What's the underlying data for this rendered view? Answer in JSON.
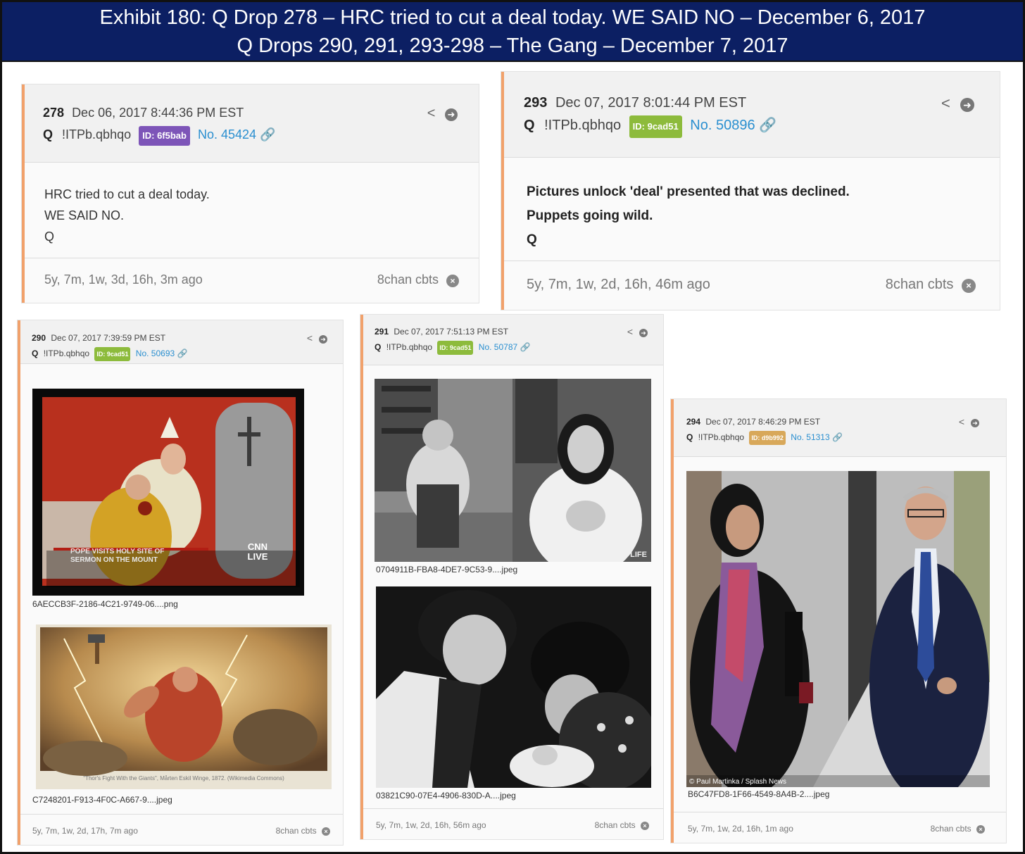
{
  "banner": {
    "line1": "Exhibit 180: Q Drop 278 – HRC tried to cut a deal today. WE SAID NO – December 6, 2017",
    "line2": "Q Drops 290, 291, 293-298 – The Gang – December 7, 2017"
  },
  "posts": [
    {
      "num": "278",
      "date": "Dec 06, 2017 8:44:36 PM EST",
      "author": "Q",
      "trip": "!ITPb.qbhqo",
      "id_label": "ID: 6f5bab",
      "post_no": "No. 45424",
      "lines": [
        "HRC tried to cut a deal today.",
        "WE SAID NO.",
        "Q"
      ],
      "ago": "5y, 7m, 1w, 3d, 16h, 3m ago",
      "board": "8chan cbts"
    },
    {
      "num": "293",
      "date": "Dec 07, 2017 8:01:44 PM EST",
      "author": "Q",
      "trip": "!ITPb.qbhqo",
      "id_label": "ID: 9cad51",
      "post_no": "No. 50896",
      "lines": [
        "Pictures unlock 'deal' presented that was declined.",
        "Puppets going wild.",
        "Q"
      ],
      "ago": "5y, 7m, 1w, 2d, 16h, 46m ago",
      "board": "8chan cbts"
    },
    {
      "num": "290",
      "date": "Dec 07, 2017 7:39:59 PM EST",
      "author": "Q",
      "trip": "!ITPb.qbhqo",
      "id_label": "ID: 9cad51",
      "post_no": "No. 50693",
      "images": [
        {
          "caption": "POPE VISITS HOLY SITE OF SERMON ON THE MOUNT",
          "logo": "CNN LIVE",
          "file": "6AECCB3F-2186-4C21-9749-06....png"
        },
        {
          "caption": "\"Thor's Fight With the Giants\", Mårten Eskil Winge, 1872. (Wikimedia Commons)",
          "file": "C7248201-F913-4F0C-A667-9....jpeg"
        }
      ],
      "ago": "5y, 7m, 1w, 2d, 17h, 7m ago",
      "board": "8chan cbts"
    },
    {
      "num": "291",
      "date": "Dec 07, 2017 7:51:13 PM EST",
      "author": "Q",
      "trip": "!ITPb.qbhqo",
      "id_label": "ID: 9cad51",
      "post_no": "No. 50787",
      "images": [
        {
          "caption": "LIFE",
          "file": "0704911B-FBA8-4DE7-9C53-9....jpeg"
        },
        {
          "caption": "",
          "file": "03821C90-07E4-4906-830D-A....jpeg"
        }
      ],
      "ago": "5y, 7m, 1w, 2d, 16h, 56m ago",
      "board": "8chan cbts"
    },
    {
      "num": "294",
      "date": "Dec 07, 2017 8:46:29 PM EST",
      "author": "Q",
      "trip": "!ITPb.qbhqo",
      "id_label": "ID: d9b992",
      "post_no": "No. 51313",
      "images": [
        {
          "caption": "© Paul Martinka / Splash News",
          "file": "B6C47FD8-1F66-4549-8A4B-2....jpeg"
        }
      ],
      "ago": "5y, 7m, 1w, 2d, 16h, 1m ago",
      "board": "8chan cbts"
    }
  ],
  "icons": {
    "share": "share-icon",
    "goto": "arrow-circle-icon",
    "link": "link-icon",
    "close": "x-circle-icon"
  },
  "colors": {
    "banner": "#0c1f63",
    "accent": "#f1a16b",
    "link": "#2a8fd0",
    "id_purple": "#7d55b8",
    "id_green": "#8dbb3c",
    "id_tan": "#d8a85a"
  }
}
